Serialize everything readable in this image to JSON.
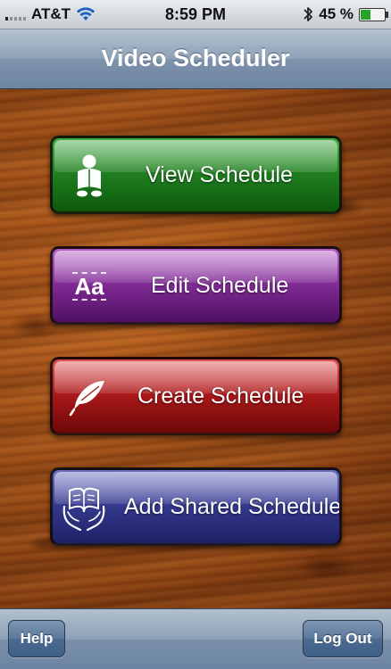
{
  "status_bar": {
    "carrier": "AT&T",
    "time": "8:59 PM",
    "battery_percent_text": "45 %",
    "battery_level": 0.45,
    "signal_bars": 5,
    "signal_bars_active": 1,
    "icons": [
      "signal-icon",
      "wifi-icon",
      "bluetooth-icon",
      "battery-icon"
    ]
  },
  "nav": {
    "title": "Video Scheduler"
  },
  "menu": {
    "items": [
      {
        "label": "View Schedule",
        "icon": "reading-person-icon",
        "color": "#1f7d1f"
      },
      {
        "label": "Edit Schedule",
        "icon": "font-aa-icon",
        "icon_text": "Aa",
        "color": "#7f2a93"
      },
      {
        "label": "Create Schedule",
        "icon": "quill-icon",
        "color": "#a81818"
      },
      {
        "label": "Add Shared Schedule",
        "icon": "hands-book-icon",
        "color": "#34388c"
      }
    ]
  },
  "toolbar": {
    "help_label": "Help",
    "logout_label": "Log Out"
  }
}
